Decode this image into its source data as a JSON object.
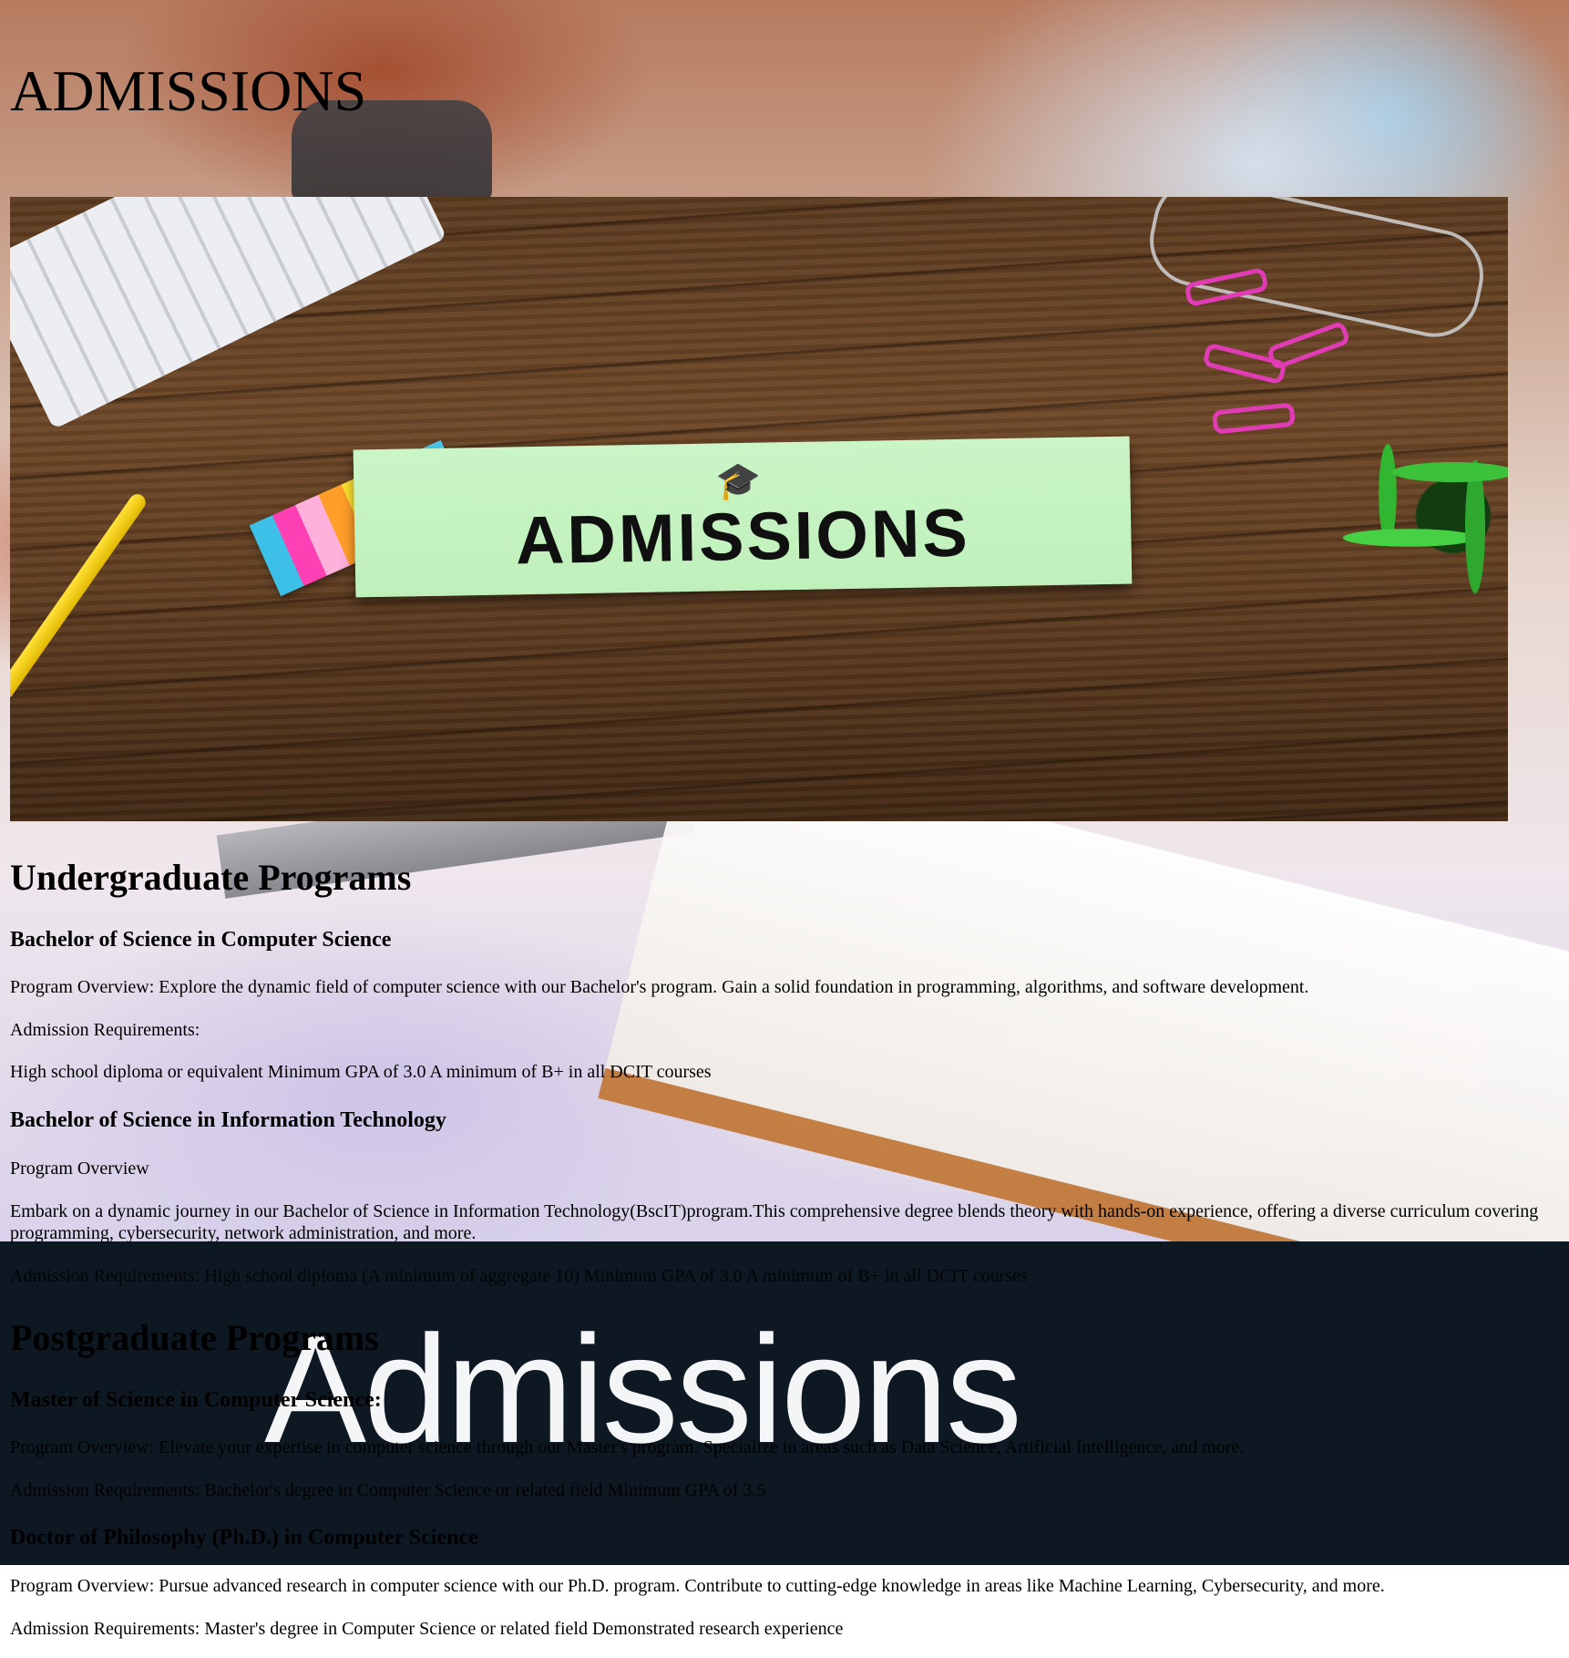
{
  "page": {
    "title": "ADMISSIONS"
  },
  "hero": {
    "sign_text": "ADMISSIONS",
    "icon": "graduation-cap-icon"
  },
  "banner": {
    "text": "Admissions"
  },
  "undergraduate": {
    "heading": "Undergraduate Programs",
    "programs": [
      {
        "title": "Bachelor of Science in Computer Science",
        "overview": "Program Overview: Explore the dynamic field of computer science with our Bachelor's program. Gain a solid foundation in programming, algorithms, and software development.",
        "requirements_label": "Admission Requirements:",
        "requirements": "High school diploma or equivalent Minimum GPA of 3.0 A minimum of B+ in all DCIT courses"
      },
      {
        "title": "Bachelor of Science in Information Technology",
        "overview_label": "Program Overview",
        "overview": "Embark on a dynamic journey in our Bachelor of Science in Information Technology(BscIT)program.This comprehensive degree blends theory with hands-on experience, offering a diverse curriculum covering programming, cybersecurity, network administration, and more.",
        "requirements": "Admission Requirements: High school diploma (A minimum of aggregate 10) Minimum GPA of 3.0 A minimum of B+ in all DCIT courses"
      }
    ]
  },
  "postgraduate": {
    "heading": "Postgraduate Programs",
    "programs": [
      {
        "title": "Master of Science in Computer Science:",
        "overview": "Program Overview: Elevate your expertise in computer science through our Master's program. Specialize in areas such as Data Science, Artificial Intelligence, and more.",
        "requirements": "Admission Requirements: Bachelor's degree in Computer Science or related field Minimum GPA of 3.5"
      },
      {
        "title": "Doctor of Philosophy (Ph.D.) in Computer Science",
        "overview": "Program Overview: Pursue advanced research in computer science with our Ph.D. program. Contribute to cutting-edge knowledge in areas like Machine Learning, Cybersecurity, and more.",
        "requirements": "Admission Requirements: Master's degree in Computer Science or related field Demonstrated research experience"
      }
    ]
  }
}
